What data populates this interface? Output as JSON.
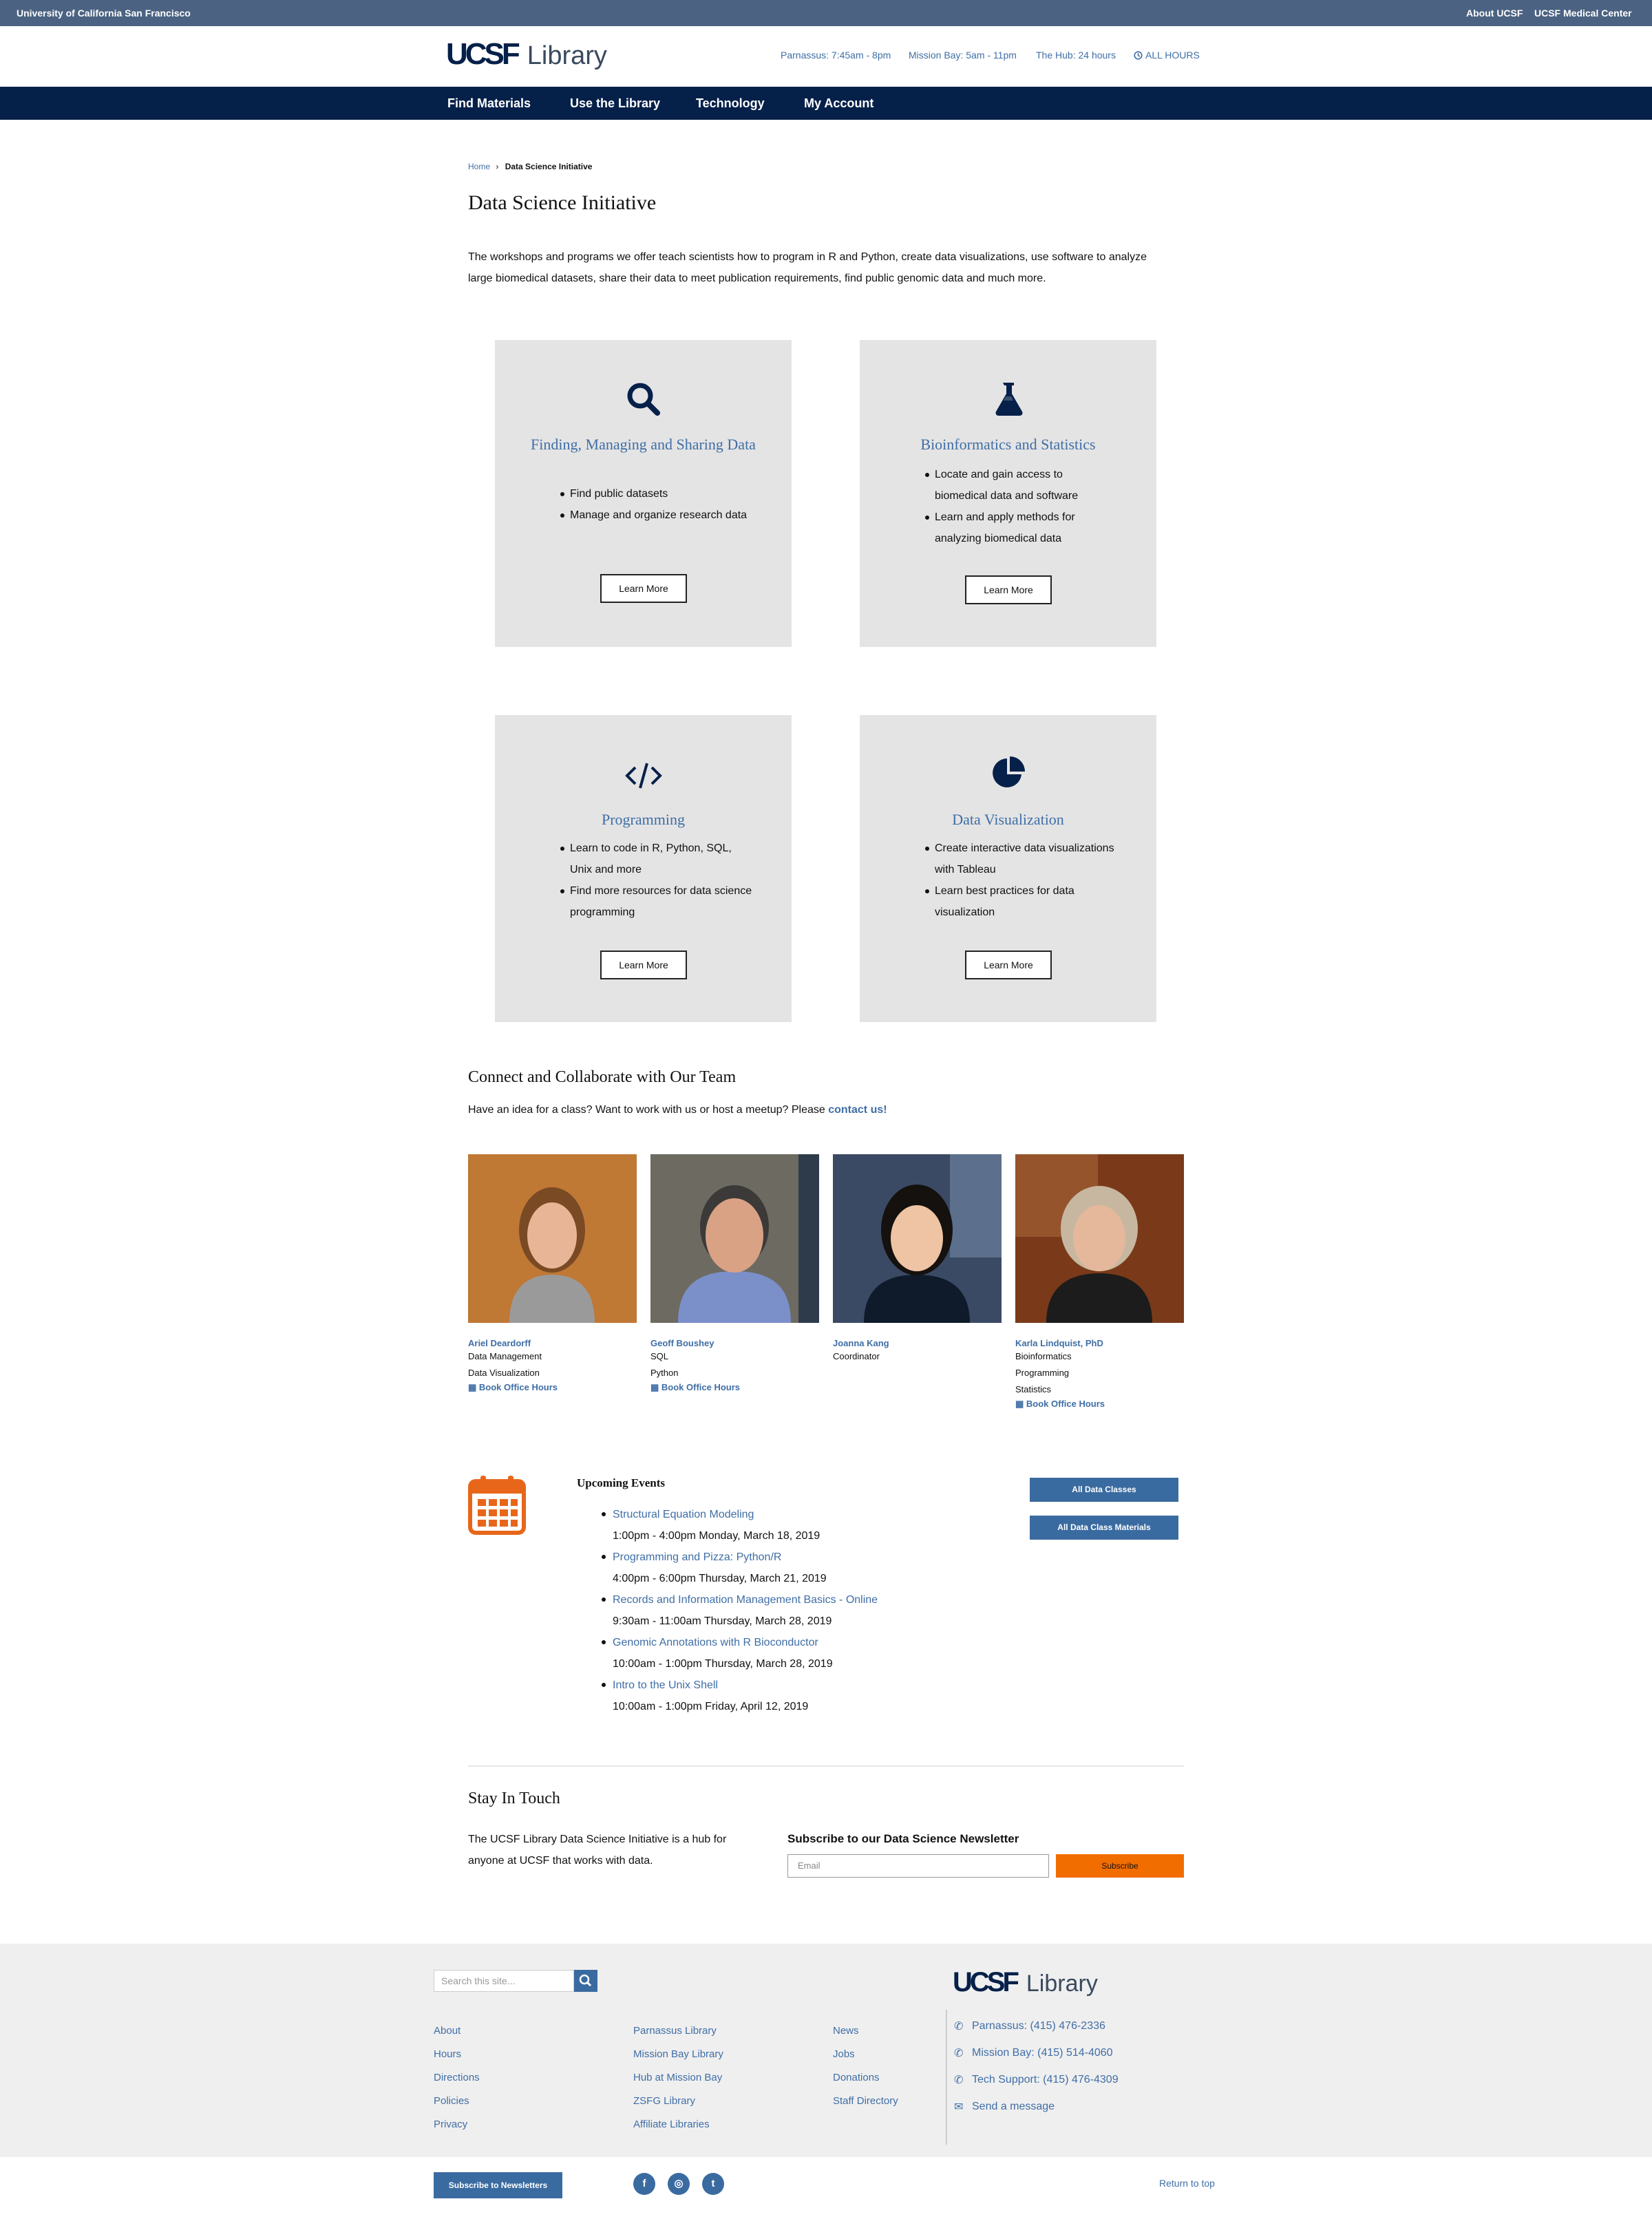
{
  "topbar": {
    "university": "University of California San Francisco",
    "about": "About UCSF",
    "medical": "UCSF Medical Center"
  },
  "logo": {
    "mark": "UCSF",
    "library": "Library"
  },
  "hours": {
    "parnassus": "Parnassus: 7:45am - 8pm",
    "mission_bay": "Mission Bay: 5am - 11pm",
    "hub": "The Hub: 24 hours",
    "all": "ALL HOURS"
  },
  "nav": [
    "Find Materials",
    "Use the Library",
    "Technology",
    "My Account"
  ],
  "breadcrumb": {
    "home": "Home",
    "current": "Data Science Initiative"
  },
  "page_title": "Data Science Initiative",
  "intro": "The workshops and programs we offer teach scientists how to program in R and Python, create data visualizations, use software to analyze large biomedical datasets, share their data to meet publication requirements, find public genomic data and much more.",
  "cards": [
    {
      "icon": "search-icon",
      "title": "Finding, Managing and Sharing Data",
      "items": [
        "Find public datasets",
        "Manage and organize research data"
      ],
      "button": "Learn More"
    },
    {
      "icon": "flask-icon",
      "title": "Bioinformatics and Statistics",
      "items": [
        "Locate and gain access to biomedical data and software",
        "Learn and apply methods for analyzing biomedical data"
      ],
      "button": "Learn More"
    },
    {
      "icon": "code-icon",
      "title": "Programming",
      "items": [
        "Learn to code in R, Python, SQL, Unix and more",
        "Find more resources for data science programming"
      ],
      "button": "Learn More"
    },
    {
      "icon": "pie-chart-icon",
      "title": "Data Visualization",
      "items": [
        "Create interactive data visualizations with Tableau",
        "Learn best practices for data visualization"
      ],
      "button": "Learn More"
    }
  ],
  "team": {
    "heading": "Connect and Collaborate with Our Team",
    "text": "Have an idea for a class? Want to work with us or host a meetup? Please",
    "link": "contact us!",
    "members": [
      {
        "name": "Ariel Deardorff",
        "roles": [
          "Data Management",
          "Data Visualization"
        ],
        "book": "Book Office Hours"
      },
      {
        "name": "Geoff Boushey",
        "roles": [
          "SQL",
          "Python"
        ],
        "book": "Book Office Hours"
      },
      {
        "name": "Joanna Kang",
        "roles": [
          "Coordinator"
        ],
        "book": ""
      },
      {
        "name": "Karla Lindquist, PhD",
        "roles": [
          "Bioinformatics",
          "Programming",
          "Statistics"
        ],
        "book": "Book Office Hours"
      }
    ]
  },
  "events": {
    "heading": "Upcoming Events",
    "items": [
      {
        "title": "Structural Equation Modeling",
        "time": "1:00pm - 4:00pm Monday, March 18, 2019"
      },
      {
        "title": "Programming and Pizza: Python/R",
        "time": "4:00pm - 6:00pm Thursday, March 21, 2019"
      },
      {
        "title": "Records and Information Management Basics - Online",
        "time": "9:30am - 11:00am Thursday, March 28, 2019"
      },
      {
        "title": "Genomic Annotations with R Bioconductor",
        "time": "10:00am - 1:00pm Thursday, March 28, 2019"
      },
      {
        "title": "Intro to the Unix Shell",
        "time": "10:00am - 1:00pm Friday, April 12, 2019"
      }
    ],
    "btn_classes": "All Data Classes",
    "btn_materials": "All Data Class Materials"
  },
  "stay": {
    "heading": "Stay In Touch",
    "text": "The UCSF Library Data Science Initiative is a hub for anyone at UCSF that works with data.",
    "newsletter_heading": "Subscribe to our Data Science Newsletter",
    "email_placeholder": "Email",
    "subscribe": "Subscribe"
  },
  "footer": {
    "search_placeholder": "Search this site...",
    "col1": [
      "About",
      "Hours",
      "Directions",
      "Policies",
      "Privacy"
    ],
    "col2": [
      "Parnassus Library",
      "Mission Bay Library",
      "Hub at Mission Bay",
      "ZSFG Library",
      "Affiliate Libraries"
    ],
    "col3": [
      "News",
      "Jobs",
      "Donations",
      "Staff Directory"
    ],
    "contacts": [
      "Parnassus: (415) 476-2336",
      "Mission Bay: (415) 514-4060",
      "Tech Support: (415) 476-4309",
      "Send a message"
    ],
    "newsletters": "Subscribe to Newsletters",
    "return_top": "Return to top"
  }
}
